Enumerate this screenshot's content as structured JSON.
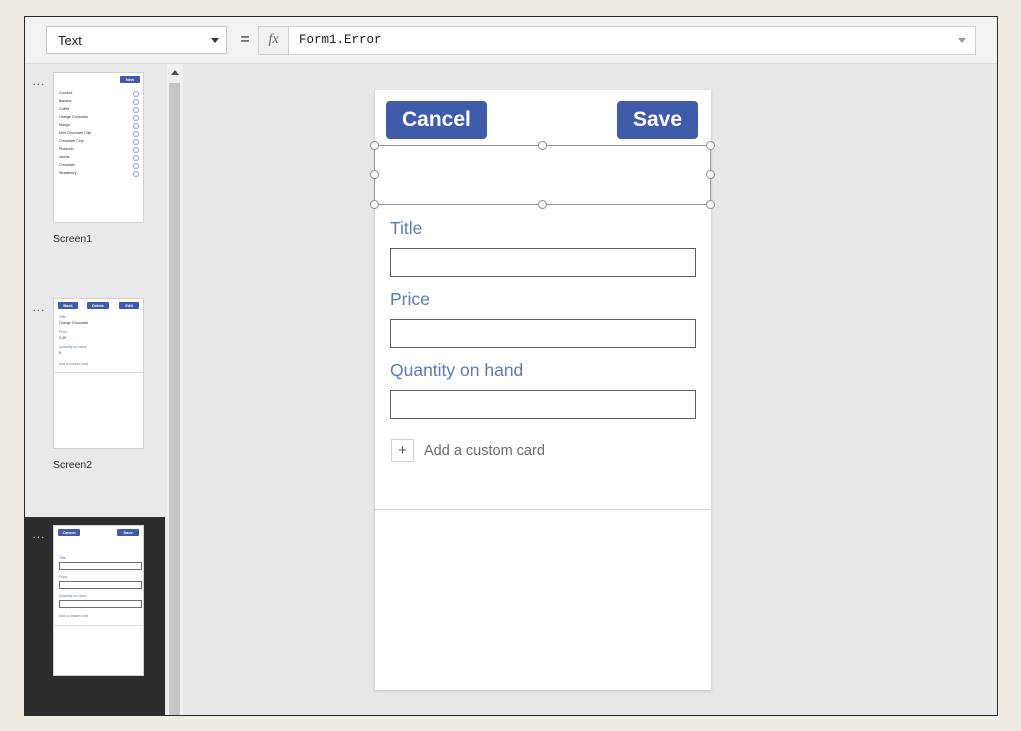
{
  "formula_bar": {
    "property_value": "Text",
    "property_options": [
      "Text"
    ],
    "equals": "=",
    "fx_icon": "fx-icon",
    "formula_value": "Form1.Error",
    "formula_placeholder": ""
  },
  "screens_pane": {
    "screens": [
      {
        "name": "Screen1",
        "selected": false,
        "overflow_menu": "...",
        "type": "gallery",
        "header_buttons": [
          {
            "label": "New"
          }
        ],
        "items": [
          "Coconut",
          "Banana",
          "Coffee",
          "Orange Chocolate",
          "Mango",
          "Mint Chocolate Chip",
          "Chocolate Chip",
          "Pistachio",
          "Vanilla",
          "Chocolate",
          "Strawberry"
        ]
      },
      {
        "name": "Screen2",
        "selected": false,
        "overflow_menu": "...",
        "type": "detail",
        "header_buttons": [
          {
            "label": "Back"
          },
          {
            "label": "Delete"
          },
          {
            "label": "Edit"
          }
        ],
        "fields": [
          {
            "label": "Title",
            "value": "Orange Chocolate"
          },
          {
            "label": "Price",
            "value": "3.45"
          },
          {
            "label": "Quantity on hand",
            "value": "5"
          }
        ],
        "add_card_label": "Add a custom card"
      },
      {
        "name": "",
        "selected": true,
        "overflow_menu": "...",
        "type": "edit",
        "header_buttons": [
          {
            "label": "Cancel"
          },
          {
            "label": "Save"
          }
        ],
        "fields": [
          {
            "label": "Title",
            "value": ""
          },
          {
            "label": "Price",
            "value": ""
          },
          {
            "label": "Quantity on hand",
            "value": ""
          }
        ],
        "add_card_label": "Add a custom card"
      }
    ]
  },
  "scrollbar": {
    "up_arrow": "chevron-up-icon"
  },
  "canvas": {
    "cancel_label": "Cancel",
    "save_label": "Save",
    "selected_control": "Form1.Error",
    "fields": [
      {
        "label": "Title",
        "value": "",
        "placeholder": ""
      },
      {
        "label": "Price",
        "value": "",
        "placeholder": ""
      },
      {
        "label": "Quantity on hand",
        "value": "",
        "placeholder": ""
      }
    ],
    "add_card_plus": "+",
    "add_card_label": "Add a custom card"
  },
  "colors": {
    "accent_blue": "#3f5ba9",
    "label_blue": "#5b7ab5",
    "window_bg": "#e7e7e8",
    "page_bg": "#efece4",
    "selected_screen_bg": "#2d2d2d"
  }
}
